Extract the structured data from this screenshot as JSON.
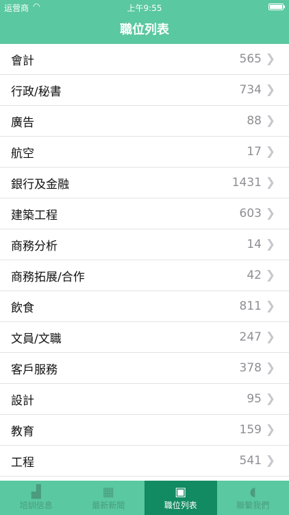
{
  "status": {
    "carrier": "运营商",
    "time": "上午9:55"
  },
  "header": {
    "title": "職位列表"
  },
  "jobs": [
    {
      "name": "會計",
      "count": "565"
    },
    {
      "name": "行政/秘書",
      "count": "734"
    },
    {
      "name": "廣告",
      "count": "88"
    },
    {
      "name": "航空",
      "count": "17"
    },
    {
      "name": "銀行及金融",
      "count": "1431"
    },
    {
      "name": "建築工程",
      "count": "603"
    },
    {
      "name": "商務分析",
      "count": "14"
    },
    {
      "name": "商務拓展/合作",
      "count": "42"
    },
    {
      "name": "飲食",
      "count": "811"
    },
    {
      "name": "文員/文職",
      "count": "247"
    },
    {
      "name": "客戶服務",
      "count": "378"
    },
    {
      "name": "設計",
      "count": "95"
    },
    {
      "name": "教育",
      "count": "159"
    },
    {
      "name": "工程",
      "count": "541"
    }
  ],
  "tabs": [
    {
      "label": "培訓信息",
      "icon": "chart-icon"
    },
    {
      "label": "最新新聞",
      "icon": "news-icon"
    },
    {
      "label": "職位列表",
      "icon": "search-icon"
    },
    {
      "label": "聯繫我們",
      "icon": "contact-icon"
    }
  ]
}
